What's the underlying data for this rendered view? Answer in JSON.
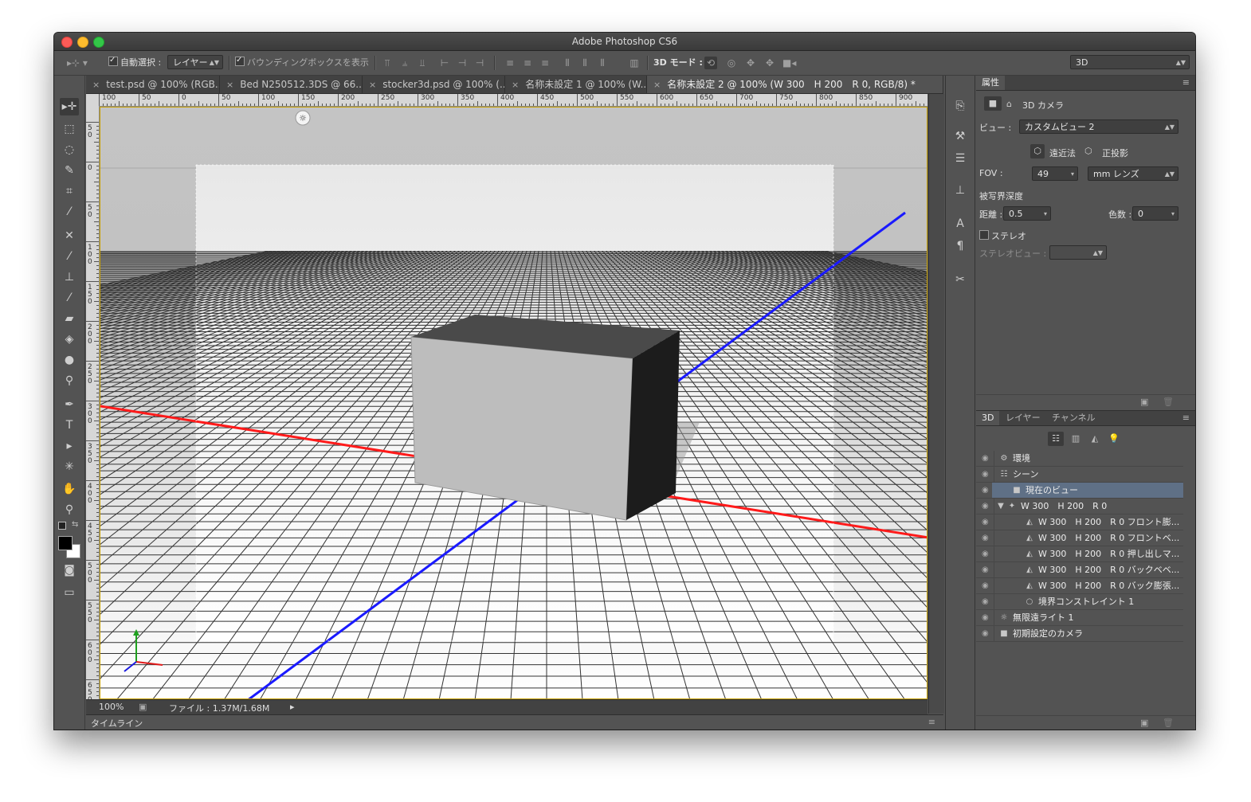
{
  "window": {
    "title": "Adobe Photoshop CS6"
  },
  "options_bar": {
    "auto_select_label": "自動選択 :",
    "auto_select_checked": true,
    "auto_select_value": "レイヤー",
    "bounding_box_label": "バウンディングボックスを表示",
    "bounding_box_checked": true,
    "mode_3d_label": "3D モード :",
    "workspace_value": "3D"
  },
  "document_tabs": [
    {
      "label": "test.psd @ 100% (RGB..."
    },
    {
      "label": "Bed N250512.3DS @ 66..."
    },
    {
      "label": "stocker3d.psd @ 100% (..."
    },
    {
      "label": "名称未設定 1 @ 100% (W..."
    },
    {
      "label": "名称未設定 2 @ 100% (W 300　H 200　R 0, RGB/8) *",
      "active": true
    }
  ],
  "ruler": {
    "top_labels": [
      "100",
      "50",
      "0",
      "50",
      "100",
      "150",
      "200",
      "250",
      "300",
      "350",
      "400",
      "450",
      "500",
      "550",
      "600",
      "650",
      "700",
      "750",
      "800",
      "850",
      "900"
    ],
    "left_labels": [
      "5\n0",
      "0",
      "5\n0",
      "1\n0\n0",
      "1\n5\n0",
      "2\n0\n0",
      "2\n5\n0",
      "3\n0\n0",
      "3\n5\n0",
      "4\n0\n0",
      "4\n5\n0",
      "5\n0\n0",
      "5\n5\n0",
      "6\n0\n0",
      "6\n5\n0"
    ]
  },
  "status_bar": {
    "zoom": "100%",
    "file_info": "ファイル : 1.37M/1.68M"
  },
  "timeline": {
    "label": "タイムライン"
  },
  "properties_panel": {
    "tab": "属性",
    "title": "3D カメラ",
    "view_label": "ビュー :",
    "view_value": "カスタムビュー 2",
    "perspective_label": "遠近法",
    "ortho_label": "正投影",
    "fov_label": "FOV :",
    "fov_value": "49",
    "fov_unit": "mm レンズ",
    "dof_label": "被写界深度",
    "distance_label": "距離 :",
    "distance_value": "0.5",
    "blur_label": "色数 :",
    "blur_value": "0",
    "stereo_label": "ステレオ",
    "stereo_view_label": "ステレオビュー :"
  },
  "layers_panel": {
    "tabs": [
      "3D",
      "レイヤー",
      "チャンネル"
    ],
    "active_tab": "3D",
    "rows": [
      {
        "label": "環境",
        "icon": "environment-icon",
        "indent": 0
      },
      {
        "label": "シーン",
        "icon": "scene-icon",
        "indent": 0
      },
      {
        "label": "現在のビュー",
        "icon": "camera-icon",
        "indent": 1,
        "selected": true
      },
      {
        "label": "W 300　H 200　R 0",
        "icon": "mesh-icon",
        "indent": 0,
        "expanded": true
      },
      {
        "label": "W 300　H 200　R 0 フロント膨...",
        "icon": "material-icon",
        "indent": 2
      },
      {
        "label": "W 300　H 200　R 0 フロントベ...",
        "icon": "material-icon",
        "indent": 2
      },
      {
        "label": "W 300　H 200　R 0 押し出しマ...",
        "icon": "material-icon",
        "indent": 2
      },
      {
        "label": "W 300　H 200　R 0 バックベベ...",
        "icon": "material-icon",
        "indent": 2
      },
      {
        "label": "W 300　H 200　R 0 バック膨張...",
        "icon": "material-icon",
        "indent": 2
      },
      {
        "label": "境界コンストレイント 1",
        "icon": "constraint-icon",
        "indent": 2
      },
      {
        "label": "無限遠ライト 1",
        "icon": "light-icon",
        "indent": 0
      },
      {
        "label": "初期設定のカメラ",
        "icon": "camera-icon",
        "indent": 0
      }
    ]
  },
  "colors": {
    "x_axis": "#ff1a1a",
    "z_axis": "#1a1aff",
    "panel_bg": "#535353",
    "selection": "#5f7086"
  }
}
